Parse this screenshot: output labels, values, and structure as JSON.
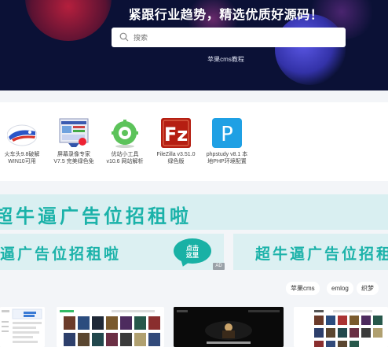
{
  "hero": {
    "title": "紧跟行业趋势，精选优质好源码！",
    "search_placeholder": "搜索",
    "link": "苹果cms教程",
    "background": "#0b1136"
  },
  "software": [
    {
      "icon": "train-ticket-icon",
      "label_line1": "火车头9.8破解",
      "label_line2": "WIN10可用"
    },
    {
      "icon": "screen-recorder-icon",
      "label_line1": "屏幕录像专家",
      "label_line2": "V7.5 完美绿色免"
    },
    {
      "icon": "site-tool-icon",
      "label_line1": "优站小工具",
      "label_line2": "v10.6 网站解析"
    },
    {
      "icon": "filezilla-icon",
      "label_line1": "FileZilla v3.51.0",
      "label_line2": "绿色版"
    },
    {
      "icon": "phpstudy-icon",
      "label_line1": "phpstudy v8.1 本",
      "label_line2": "地PHP环境配置"
    }
  ],
  "ads": {
    "banner_text": "超牛逼广告位招租啦",
    "banner_text_left": "逼广告位招租啦",
    "bubble_line1": "点击",
    "bubble_line2": "这里",
    "badge": "AD",
    "accent": "#1bb2a9"
  },
  "tags": [
    "苹果cms",
    "emlog",
    "织梦"
  ]
}
